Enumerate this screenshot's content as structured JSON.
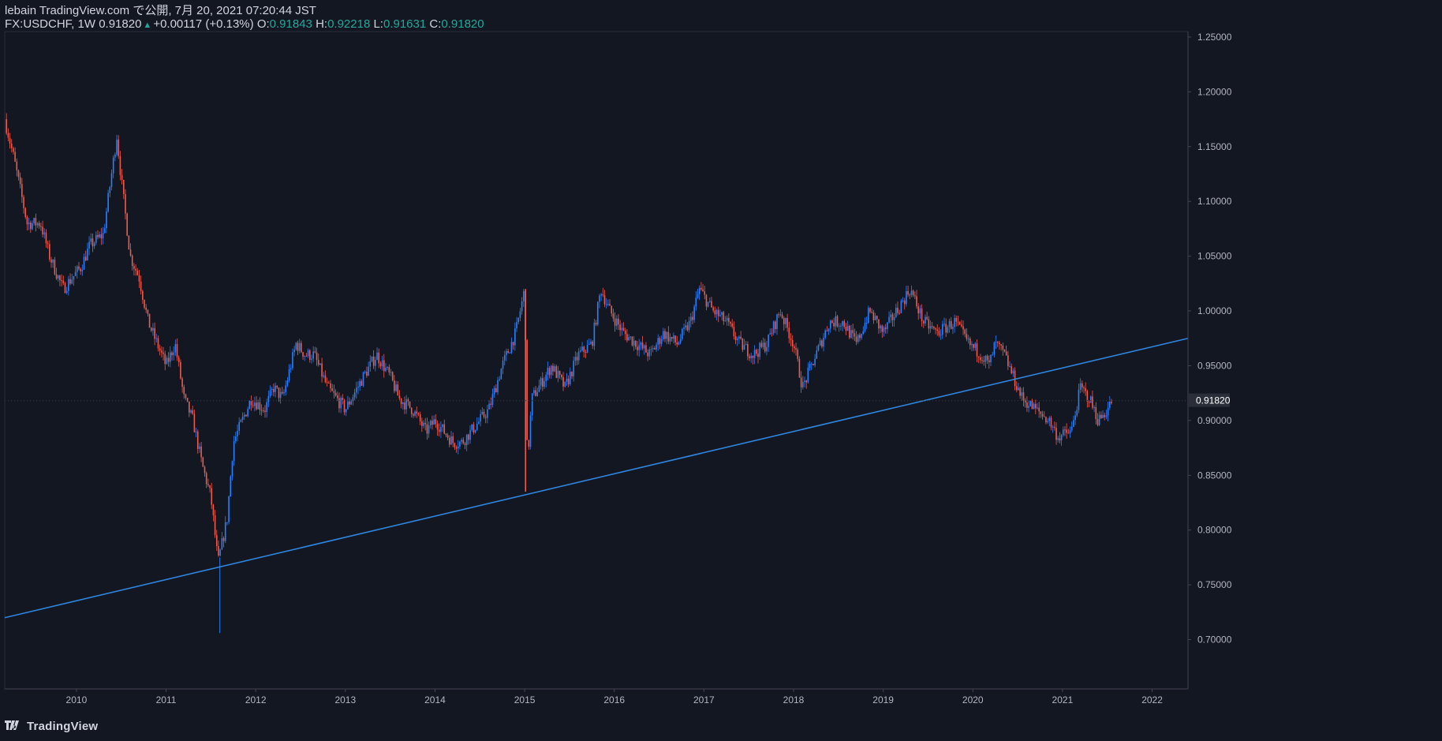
{
  "header": {
    "published": "lebain TradingView.com で公開, 7月 20, 2021 07:20:44 JST",
    "symbol": "FX:USDCHF, 1W",
    "last": "0.91820",
    "change": "+0.00117 (+0.13%)",
    "o_label": "O:",
    "o_value": "0.91843",
    "h_label": "H:",
    "h_value": "0.92218",
    "l_label": "L:",
    "l_value": "0.91631",
    "c_label": "C:",
    "c_value": "0.91820"
  },
  "footer": {
    "brand": "TradingView"
  },
  "colors": {
    "background": "#131722",
    "up": "#2a7fff",
    "down": "#f05a4c",
    "trendline": "#2e86de",
    "text": "#d1d4dc",
    "teal": "#26a69a"
  },
  "chart_data": {
    "type": "candlestick",
    "symbol": "FX:USDCHF",
    "interval": "1W",
    "last_price_label": "0.91820",
    "x_range": [
      2009.2,
      2022.4
    ],
    "ylim": [
      0.655,
      1.255
    ],
    "x_ticks": [
      "2010",
      "2011",
      "2012",
      "2013",
      "2014",
      "2015",
      "2016",
      "2017",
      "2018",
      "2019",
      "2020",
      "2021",
      "2022"
    ],
    "y_ticks": [
      "0.70000",
      "0.75000",
      "0.80000",
      "0.85000",
      "0.90000",
      "0.95000",
      "1.00000",
      "1.05000",
      "1.10000",
      "1.15000",
      "1.20000",
      "1.25000"
    ],
    "approximate_weekly_close_path": [
      [
        2009.2,
        1.175
      ],
      [
        2009.3,
        1.14
      ],
      [
        2009.45,
        1.08
      ],
      [
        2009.6,
        1.08
      ],
      [
        2009.7,
        1.05
      ],
      [
        2009.85,
        1.02
      ],
      [
        2009.95,
        1.03
      ],
      [
        2010.05,
        1.04
      ],
      [
        2010.15,
        1.06
      ],
      [
        2010.3,
        1.07
      ],
      [
        2010.45,
        1.16
      ],
      [
        2010.5,
        1.12
      ],
      [
        2010.6,
        1.05
      ],
      [
        2010.7,
        1.03
      ],
      [
        2010.8,
        0.99
      ],
      [
        2010.9,
        0.97
      ],
      [
        2011.0,
        0.95
      ],
      [
        2011.1,
        0.97
      ],
      [
        2011.2,
        0.92
      ],
      [
        2011.3,
        0.9
      ],
      [
        2011.4,
        0.86
      ],
      [
        2011.5,
        0.83
      ],
      [
        2011.58,
        0.77
      ],
      [
        2011.68,
        0.81
      ],
      [
        2011.75,
        0.88
      ],
      [
        2011.85,
        0.9
      ],
      [
        2011.95,
        0.92
      ],
      [
        2012.1,
        0.91
      ],
      [
        2012.2,
        0.93
      ],
      [
        2012.3,
        0.92
      ],
      [
        2012.45,
        0.97
      ],
      [
        2012.55,
        0.96
      ],
      [
        2012.65,
        0.96
      ],
      [
        2012.8,
        0.93
      ],
      [
        2012.9,
        0.92
      ],
      [
        2013.0,
        0.91
      ],
      [
        2013.2,
        0.94
      ],
      [
        2013.35,
        0.96
      ],
      [
        2013.5,
        0.94
      ],
      [
        2013.6,
        0.92
      ],
      [
        2013.75,
        0.91
      ],
      [
        2013.9,
        0.89
      ],
      [
        2014.0,
        0.9
      ],
      [
        2014.2,
        0.88
      ],
      [
        2014.3,
        0.88
      ],
      [
        2014.45,
        0.895
      ],
      [
        2014.6,
        0.91
      ],
      [
        2014.75,
        0.95
      ],
      [
        2014.9,
        0.98
      ],
      [
        2015.0,
        1.02
      ],
      [
        2015.03,
        0.86
      ],
      [
        2015.08,
        0.92
      ],
      [
        2015.3,
        0.95
      ],
      [
        2015.45,
        0.93
      ],
      [
        2015.6,
        0.96
      ],
      [
        2015.75,
        0.97
      ],
      [
        2015.85,
        1.02
      ],
      [
        2015.95,
        1.0
      ],
      [
        2016.1,
        0.98
      ],
      [
        2016.25,
        0.97
      ],
      [
        2016.4,
        0.96
      ],
      [
        2016.55,
        0.98
      ],
      [
        2016.7,
        0.97
      ],
      [
        2016.85,
        0.99
      ],
      [
        2016.95,
        1.02
      ],
      [
        2017.1,
        1.0
      ],
      [
        2017.25,
        0.99
      ],
      [
        2017.4,
        0.97
      ],
      [
        2017.55,
        0.96
      ],
      [
        2017.7,
        0.97
      ],
      [
        2017.85,
        1.0
      ],
      [
        2018.0,
        0.97
      ],
      [
        2018.1,
        0.93
      ],
      [
        2018.25,
        0.96
      ],
      [
        2018.4,
        0.99
      ],
      [
        2018.55,
        0.99
      ],
      [
        2018.7,
        0.97
      ],
      [
        2018.85,
        1.0
      ],
      [
        2019.0,
        0.98
      ],
      [
        2019.15,
        1.0
      ],
      [
        2019.3,
        1.02
      ],
      [
        2019.45,
        0.99
      ],
      [
        2019.6,
        0.98
      ],
      [
        2019.8,
        0.99
      ],
      [
        2019.95,
        0.97
      ],
      [
        2020.1,
        0.96
      ],
      [
        2020.18,
        0.95
      ],
      [
        2020.25,
        0.97
      ],
      [
        2020.35,
        0.96
      ],
      [
        2020.45,
        0.94
      ],
      [
        2020.55,
        0.92
      ],
      [
        2020.7,
        0.91
      ],
      [
        2020.85,
        0.9
      ],
      [
        2020.95,
        0.885
      ],
      [
        2021.1,
        0.89
      ],
      [
        2021.2,
        0.93
      ],
      [
        2021.3,
        0.92
      ],
      [
        2021.4,
        0.9
      ],
      [
        2021.5,
        0.91
      ],
      [
        2021.55,
        0.918
      ]
    ],
    "trendline": {
      "from": [
        2009.2,
        0.72
      ],
      "to": [
        2022.4,
        0.975
      ]
    }
  }
}
